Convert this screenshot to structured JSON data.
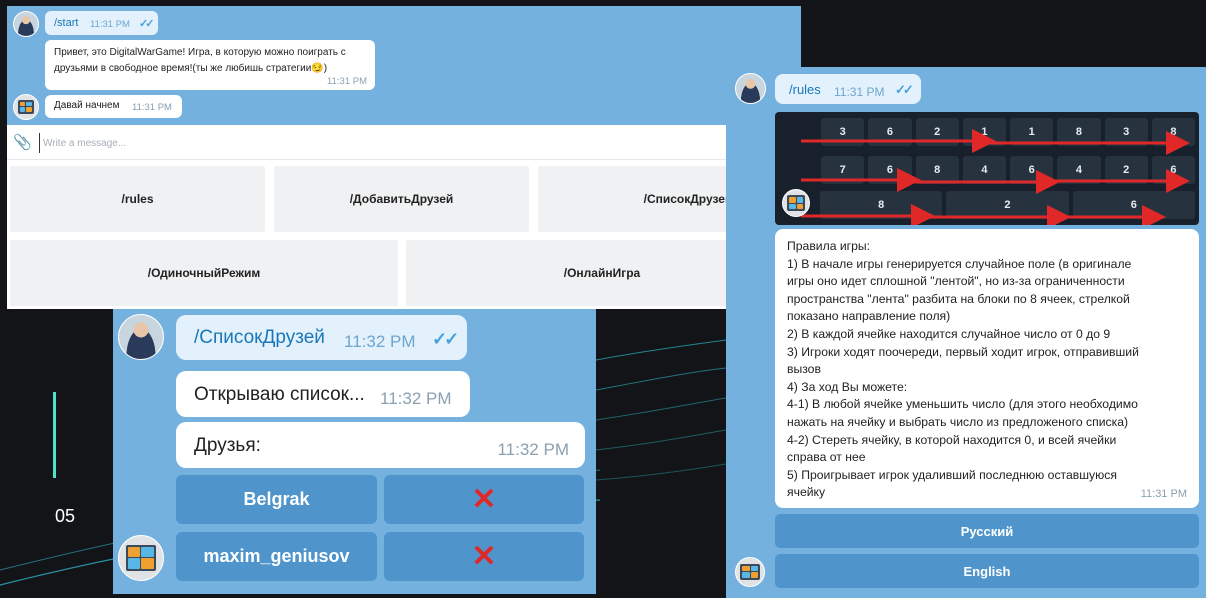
{
  "slide": {
    "number": "05"
  },
  "chat1": {
    "start_cmd": "/start",
    "start_time": "11:31 PM",
    "greeting_line1": "Привет, это DigitalWarGame! Игра, в которую можно поиграть с",
    "greeting_line2": "друзьями в свободное время!(ты же любишь стратегии😏)",
    "greeting_time": "11:31 PM",
    "lets_start": "Давай начнем",
    "lets_start_time": "11:31 PM",
    "input_placeholder": "Write a message...",
    "keyboard": {
      "rules": "/rules",
      "add_friends": "/ДобавитьДрузей",
      "friend_list": "/СписокДрузей",
      "single_mode": "/ОдиночныйРежим",
      "online_game": "/ОнлайнИгра"
    }
  },
  "chat2": {
    "cmd": "/СписокДрузей",
    "cmd_time": "11:32 PM",
    "opening": "Открываю список...",
    "opening_time": "11:32 PM",
    "friends_label": "Друзья:",
    "friends_time": "11:32 PM",
    "friends": [
      {
        "name": "Belgrak",
        "remove_icon": "✕"
      },
      {
        "name": "maxim_geniusov",
        "remove_icon": "✕"
      }
    ]
  },
  "chat3": {
    "cmd": "/rules",
    "cmd_time": "11:31 PM",
    "board_rows": [
      [
        "3",
        "6",
        "2",
        "1",
        "1",
        "8",
        "3",
        "8"
      ],
      [
        "7",
        "6",
        "8",
        "4",
        "6",
        "4",
        "2",
        "6"
      ],
      [
        "8",
        "2",
        "6"
      ]
    ],
    "rules_lines": [
      "Правила игры:",
      "1) В начале игры генерируется случайное поле (в оригинале",
      "игры оно идет сплошной \"лентой\", но из-за ограниченности",
      "пространства \"лента\" разбита на блоки по 8 ячеек, стрелкой",
      "показано направление поля)",
      "2) В каждой ячейке находится случайное число от 0 до 9",
      "3) Игроки ходят поочереди, первый ходит игрок, отправивший",
      "вызов",
      "4) За ход Вы можете:",
      "4-1) В любой ячейке уменьшить число (для этого необходимо",
      "нажать на ячейку и выбрать число из предложеного списка)",
      "4-2) Стереть ячейку, в которой находится 0, и всей ячейки",
      "справа от нее",
      "5) Проигрывает игрок удаливший последнюю оставшуюся",
      "ячейку"
    ],
    "rules_time": "11:31 PM",
    "lang_buttons": [
      "Русский",
      "English"
    ]
  },
  "colors": {
    "chat_bg": "#74b1df",
    "outgoing_bubble": "#e2f1fb",
    "inline_button": "#4f95cc",
    "arrow": "#e02828",
    "accent_line": "#4fe0c8"
  }
}
